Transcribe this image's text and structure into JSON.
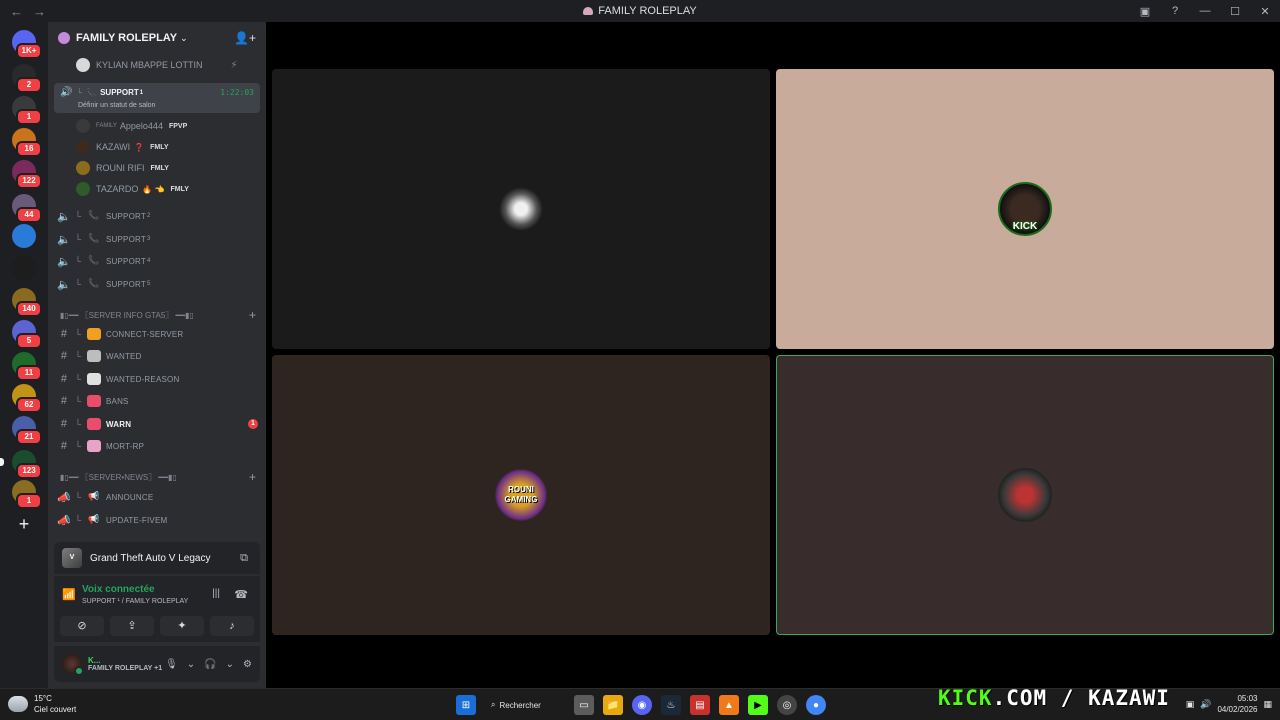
{
  "window": {
    "title": "FAMILY ROLEPLAY",
    "back": "←",
    "forward": "→"
  },
  "servers": [
    {
      "badge": "1K+",
      "color": "#5865f2"
    },
    {
      "badge": "2",
      "color": "#2a2a2a"
    },
    {
      "badge": "1",
      "color": "#3a3a3a"
    },
    {
      "badge": "16",
      "color": "#c9731c"
    },
    {
      "badge": "122",
      "color": "#7a2b5c"
    },
    {
      "badge": "44",
      "color": "#6a5a7a"
    },
    {
      "badge": "",
      "color": "#2a7ad8"
    },
    {
      "badge": "",
      "color": "#1d1d1d"
    },
    {
      "badge": "140",
      "color": "#8a6a1f"
    },
    {
      "badge": "5",
      "color": "#5b64d1"
    },
    {
      "badge": "11",
      "color": "#1f6b2a"
    },
    {
      "badge": "62",
      "color": "#c29416"
    },
    {
      "badge": "21",
      "color": "#4a5fa8"
    },
    {
      "badge": "123",
      "color": "#1a4d2e"
    },
    {
      "badge": "1",
      "color": "#8a6d22"
    }
  ],
  "guild": {
    "name": "FAMILY ROLEPLAY",
    "chevron": "⌄",
    "invite_icon": "👤+"
  },
  "channels": {
    "top_user": "KYLIAN MBAPPE LOTTIN",
    "active_voice": {
      "name": "SUPPORT",
      "sup": "1",
      "status": "Définir un statut de salon",
      "timer": "1:22:03"
    },
    "voice_users": [
      {
        "name": "Appelo444",
        "prefix": "FAMILY",
        "tag": "FPVP",
        "color": "#3a3a3a"
      },
      {
        "name": "KAZAWI",
        "tag": "FMLY",
        "extra": "❓",
        "color": "#3b2a20"
      },
      {
        "name": "ROUNI RIFI",
        "tag": "FMLY",
        "color": "#8b6b1e"
      },
      {
        "name": "TAZARDO",
        "tag": "FMLY",
        "extra": "🔥 👈",
        "color": "#2f5a2a"
      }
    ],
    "support_rooms": [
      {
        "name": "SUPPORT",
        "sup": "2"
      },
      {
        "name": "SUPPORT",
        "sup": "3"
      },
      {
        "name": "SUPPORT",
        "sup": "4"
      },
      {
        "name": "SUPPORT",
        "sup": "5"
      }
    ],
    "category1": "▮▯━━ 〖SERVER INFO GTA5〗 ━━▮▯",
    "info_channels": [
      {
        "name": "CONNECT-SERVER",
        "color": "#f0a020"
      },
      {
        "name": "WANTED",
        "color": "#bdbdbd"
      },
      {
        "name": "WANTED-REASON",
        "color": "#e0e0e0"
      },
      {
        "name": "BANS",
        "color": "#ea4c6b"
      },
      {
        "name": "WARN",
        "color": "#ea4c6b",
        "mention": "1"
      },
      {
        "name": "MORT-RP",
        "color": "#e8a3c8"
      }
    ],
    "category2": "▮▯━━ 〖SERVER•NEWS〗 ━━▮▯",
    "news_channels": [
      {
        "name": "ANNOUNCE"
      },
      {
        "name": "UPDATE-FIVEM"
      }
    ]
  },
  "activity": {
    "game": "Grand Theft Auto V Legacy",
    "logo": "V"
  },
  "voice_panel": {
    "status": "Voix connectée",
    "location": "SUPPORT ¹ / FAMILY ROLEPLAY"
  },
  "user_panel": {
    "name": "K...",
    "status": "FAMILY ROLEPLAY +1"
  },
  "tiles": [
    {
      "bg": "#1b1b1b"
    },
    {
      "bg": "#c8ab9a",
      "avatar_text": "KICK"
    },
    {
      "bg": "#2e2420",
      "avatar_text": "ROUNI GAMING"
    },
    {
      "bg": "#392c2d"
    }
  ],
  "taskbar": {
    "temp": "15°C",
    "weather": "Ciel couvert",
    "search": "Rechercher",
    "overlay_brand": "KICK",
    "overlay_rest": ".COM / KAZAWI",
    "time": "05:03",
    "date": "04/02/2026"
  }
}
